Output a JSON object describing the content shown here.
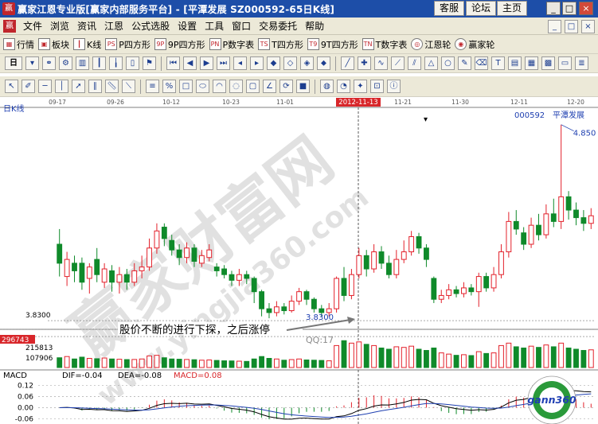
{
  "window": {
    "title": "赢家江恩专业版[赢家内部服务平台] - [平潭发展  SZ000592-65日K线]",
    "buttons": [
      "客服",
      "论坛",
      "主页"
    ],
    "controls": [
      "_",
      "□",
      "×"
    ]
  },
  "menu": {
    "items": [
      "文件",
      "浏览",
      "资讯",
      "江恩",
      "公式选股",
      "设置",
      "工具",
      "窗口",
      "交易委托",
      "帮助"
    ],
    "right_controls": [
      "_",
      "□",
      "×"
    ]
  },
  "toolbar1": [
    {
      "icon": "grid-icon",
      "label": "行情"
    },
    {
      "icon": "block-icon",
      "label": "板块"
    },
    {
      "icon": "kline-icon",
      "label": "K线"
    },
    {
      "icon": "ps",
      "label": "P四方形"
    },
    {
      "icon": "9p",
      "label": "9P四方形"
    },
    {
      "icon": "pn",
      "label": "P数字表"
    },
    {
      "icon": "ts",
      "label": "T四方形"
    },
    {
      "icon": "t9",
      "label": "9T四方形"
    },
    {
      "icon": "tn",
      "label": "T数字表"
    },
    {
      "icon": "wheel-icon",
      "label": "江恩轮"
    },
    {
      "icon": "wheel2-icon",
      "label": "赢家轮"
    }
  ],
  "toolbar2_label": "日",
  "toolbar3_label": "日K线",
  "chart_data": {
    "type": "candlestick",
    "stock_code": "000592",
    "stock_name": "平潭发展",
    "period": "日K线",
    "date_labels": [
      "09-17",
      "09-26",
      "10-12",
      "10-23",
      "11-01",
      "2012-11-13",
      "11-21",
      "11-30",
      "12-11",
      "12-20"
    ],
    "high_label": "4.850",
    "low_label": "3.8300",
    "low_axis_label": "3.8300",
    "annotation": "股价不断的进行下探，之后涨停",
    "watermark_text": "赢家财富网",
    "watermark_url": "www.yingjia360.com",
    "qq_text": "QQ:17",
    "volume_labels": [
      "296743",
      "215813",
      "107906"
    ],
    "macd": {
      "title": "MACD",
      "dif": "DIF=-0.04",
      "dea": "DEA=-0.08",
      "macd": "MACD=0.08",
      "y_ticks": [
        "0.12",
        "0.06",
        "0.00",
        "-0.06"
      ]
    },
    "logo_text": "gann360",
    "candles": [
      {
        "o": 4.22,
        "c": 4.12,
        "h": 4.3,
        "l": 4.05,
        "v": 80000
      },
      {
        "o": 4.05,
        "c": 4.14,
        "h": 4.18,
        "l": 4.0,
        "v": 90000
      },
      {
        "o": 4.12,
        "c": 4.08,
        "h": 4.16,
        "l": 4.02,
        "v": 70000
      },
      {
        "o": 4.12,
        "c": 4.02,
        "h": 4.15,
        "l": 3.98,
        "v": 85000
      },
      {
        "o": 4.04,
        "c": 4.1,
        "h": 4.12,
        "l": 3.96,
        "v": 75000
      },
      {
        "o": 4.14,
        "c": 4.06,
        "h": 4.2,
        "l": 4.02,
        "v": 72000
      },
      {
        "o": 4.02,
        "c": 4.09,
        "h": 4.12,
        "l": 3.99,
        "v": 78000
      },
      {
        "o": 4.08,
        "c": 4.02,
        "h": 4.11,
        "l": 3.97,
        "v": 70000
      },
      {
        "o": 4.02,
        "c": 4.06,
        "h": 4.1,
        "l": 3.96,
        "v": 68000
      },
      {
        "o": 4.06,
        "c": 4.02,
        "h": 4.09,
        "l": 3.98,
        "v": 65000
      },
      {
        "o": 4.02,
        "c": 4.08,
        "h": 4.12,
        "l": 4.0,
        "v": 66000
      },
      {
        "o": 4.08,
        "c": 4.1,
        "h": 4.16,
        "l": 4.04,
        "v": 70000
      },
      {
        "o": 4.1,
        "c": 4.2,
        "h": 4.25,
        "l": 4.08,
        "v": 95000
      },
      {
        "o": 4.2,
        "c": 4.29,
        "h": 4.33,
        "l": 4.17,
        "v": 100000
      },
      {
        "o": 4.31,
        "c": 4.25,
        "h": 4.33,
        "l": 4.21,
        "v": 80000
      },
      {
        "o": 4.24,
        "c": 4.19,
        "h": 4.27,
        "l": 4.16,
        "v": 70000
      },
      {
        "o": 4.19,
        "c": 4.15,
        "h": 4.22,
        "l": 4.11,
        "v": 68000
      },
      {
        "o": 4.15,
        "c": 4.2,
        "h": 4.23,
        "l": 4.12,
        "v": 66000
      },
      {
        "o": 4.2,
        "c": 4.13,
        "h": 4.22,
        "l": 4.1,
        "v": 64000
      },
      {
        "o": 4.12,
        "c": 4.16,
        "h": 4.19,
        "l": 4.1,
        "v": 60000
      },
      {
        "o": 4.15,
        "c": 4.19,
        "h": 4.22,
        "l": 4.13,
        "v": 62000
      },
      {
        "o": 4.1,
        "c": 4.08,
        "h": 4.12,
        "l": 4.05,
        "v": 58000
      },
      {
        "o": 4.09,
        "c": 4.06,
        "h": 4.11,
        "l": 4.04,
        "v": 55000
      },
      {
        "o": 4.06,
        "c": 4.03,
        "h": 4.08,
        "l": 4.0,
        "v": 54000
      },
      {
        "o": 4.03,
        "c": 4.06,
        "h": 4.09,
        "l": 4.0,
        "v": 52000
      },
      {
        "o": 4.06,
        "c": 4.04,
        "h": 4.08,
        "l": 4.01,
        "v": 50000
      },
      {
        "o": 4.04,
        "c": 3.97,
        "h": 4.05,
        "l": 3.91,
        "v": 70000
      },
      {
        "o": 3.97,
        "c": 3.88,
        "h": 3.98,
        "l": 3.84,
        "v": 90000
      },
      {
        "o": 3.88,
        "c": 3.86,
        "h": 3.91,
        "l": 3.83,
        "v": 75000
      },
      {
        "o": 3.86,
        "c": 3.89,
        "h": 3.92,
        "l": 3.84,
        "v": 70000
      },
      {
        "o": 3.89,
        "c": 3.87,
        "h": 3.91,
        "l": 3.85,
        "v": 60000
      },
      {
        "o": 3.87,
        "c": 3.92,
        "h": 3.95,
        "l": 3.86,
        "v": 65000
      },
      {
        "o": 3.92,
        "c": 3.97,
        "h": 3.99,
        "l": 3.9,
        "v": 70000
      },
      {
        "o": 3.97,
        "c": 3.93,
        "h": 3.98,
        "l": 3.9,
        "v": 62000
      },
      {
        "o": 3.93,
        "c": 3.88,
        "h": 3.94,
        "l": 3.86,
        "v": 60000
      },
      {
        "o": 3.88,
        "c": 3.86,
        "h": 3.9,
        "l": 3.84,
        "v": 58000
      },
      {
        "o": 3.86,
        "c": 3.88,
        "h": 3.91,
        "l": 3.84,
        "v": 55000
      },
      {
        "o": 3.88,
        "c": 4.04,
        "h": 4.05,
        "l": 3.86,
        "v": 180000
      },
      {
        "o": 4.04,
        "c": 3.95,
        "h": 4.1,
        "l": 3.92,
        "v": 220000
      },
      {
        "o": 3.95,
        "c": 4.06,
        "h": 4.09,
        "l": 3.93,
        "v": 200000
      },
      {
        "o": 4.06,
        "c": 4.16,
        "h": 4.2,
        "l": 4.04,
        "v": 210000
      },
      {
        "o": 4.16,
        "c": 4.09,
        "h": 4.19,
        "l": 4.05,
        "v": 190000
      },
      {
        "o": 4.09,
        "c": 4.18,
        "h": 4.22,
        "l": 4.07,
        "v": 180000
      },
      {
        "o": 4.18,
        "c": 4.12,
        "h": 4.21,
        "l": 4.09,
        "v": 160000
      },
      {
        "o": 4.12,
        "c": 4.06,
        "h": 4.16,
        "l": 4.04,
        "v": 150000
      },
      {
        "o": 4.06,
        "c": 4.14,
        "h": 4.19,
        "l": 4.04,
        "v": 170000
      },
      {
        "o": 4.14,
        "c": 4.18,
        "h": 4.24,
        "l": 4.12,
        "v": 165000
      },
      {
        "o": 4.18,
        "c": 4.26,
        "h": 4.29,
        "l": 4.16,
        "v": 175000
      },
      {
        "o": 4.26,
        "c": 4.2,
        "h": 4.28,
        "l": 4.17,
        "v": 150000
      },
      {
        "o": 4.2,
        "c": 4.14,
        "h": 4.22,
        "l": 4.1,
        "v": 140000
      },
      {
        "o": 4.04,
        "c": 3.93,
        "h": 4.05,
        "l": 3.91,
        "v": 160000
      },
      {
        "o": 3.93,
        "c": 3.95,
        "h": 3.98,
        "l": 3.91,
        "v": 120000
      },
      {
        "o": 3.95,
        "c": 3.98,
        "h": 4.01,
        "l": 3.93,
        "v": 110000
      },
      {
        "o": 3.98,
        "c": 3.96,
        "h": 4.0,
        "l": 3.94,
        "v": 100000
      },
      {
        "o": 3.96,
        "c": 3.99,
        "h": 4.02,
        "l": 3.94,
        "v": 105000
      },
      {
        "o": 3.99,
        "c": 3.97,
        "h": 4.01,
        "l": 3.95,
        "v": 98000
      },
      {
        "o": 3.97,
        "c": 4.05,
        "h": 4.07,
        "l": 3.89,
        "v": 130000
      },
      {
        "o": 4.05,
        "c": 3.99,
        "h": 4.07,
        "l": 3.97,
        "v": 115000
      },
      {
        "o": 3.99,
        "c": 4.06,
        "h": 4.1,
        "l": 3.97,
        "v": 120000
      },
      {
        "o": 4.06,
        "c": 4.18,
        "h": 4.22,
        "l": 4.04,
        "v": 180000
      },
      {
        "o": 4.18,
        "c": 4.34,
        "h": 4.39,
        "l": 4.15,
        "v": 200000
      },
      {
        "o": 4.34,
        "c": 4.3,
        "h": 4.4,
        "l": 4.27,
        "v": 170000
      },
      {
        "o": 4.28,
        "c": 4.22,
        "h": 4.31,
        "l": 4.19,
        "v": 160000
      },
      {
        "o": 4.22,
        "c": 4.32,
        "h": 4.36,
        "l": 4.2,
        "v": 175000
      },
      {
        "o": 4.32,
        "c": 4.27,
        "h": 4.38,
        "l": 4.24,
        "v": 165000
      },
      {
        "o": 4.27,
        "c": 4.38,
        "h": 4.43,
        "l": 4.25,
        "v": 185000
      },
      {
        "o": 4.38,
        "c": 4.34,
        "h": 4.46,
        "l": 4.31,
        "v": 170000
      },
      {
        "o": 4.34,
        "c": 4.47,
        "h": 4.85,
        "l": 4.3,
        "v": 200000
      },
      {
        "o": 4.47,
        "c": 4.4,
        "h": 4.5,
        "l": 4.35,
        "v": 160000
      },
      {
        "o": 4.4,
        "c": 4.36,
        "h": 4.44,
        "l": 4.32,
        "v": 150000
      },
      {
        "o": 4.36,
        "c": 4.33,
        "h": 4.4,
        "l": 4.29,
        "v": 140000
      },
      {
        "o": 4.33,
        "c": 4.37,
        "h": 4.41,
        "l": 4.3,
        "v": 145000
      }
    ],
    "colors": {
      "up": "#e3212b",
      "down": "#0f8a2a",
      "axis": "#000000",
      "label": "#1e3fb0"
    }
  }
}
